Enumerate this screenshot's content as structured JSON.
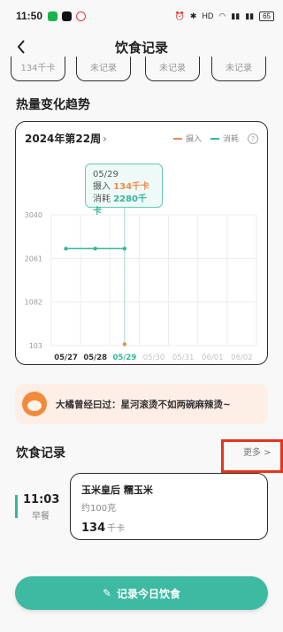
{
  "status_bar": {
    "time": "11:50",
    "battery": "65",
    "network": "HD"
  },
  "nav": {
    "back_icon": "back-icon",
    "title": "饮食记录"
  },
  "day_chips": [
    "134千卡",
    "未记录",
    "未记录",
    "未记录",
    "未记录"
  ],
  "trend": {
    "section_title": "热量变化趋势",
    "week_label": "2024年第22周",
    "legend_intake": "摄入",
    "legend_burn": "消耗",
    "tooltip": {
      "date": "05/29",
      "intake_label": "摄入",
      "intake_value": "134千卡",
      "burn_label": "消耗",
      "burn_value": "2280千卡"
    }
  },
  "chart_data": {
    "type": "line",
    "categories": [
      "05/27",
      "05/28",
      "05/29",
      "05/30",
      "05/31",
      "06/01",
      "06/02"
    ],
    "y_ticks": [
      "3040",
      "2061",
      "1082",
      "103"
    ],
    "ylim": [
      103,
      3040
    ],
    "selected_category": "05/29",
    "series": [
      {
        "name": "消耗",
        "color": "#38b49d",
        "values": [
          2280,
          2280,
          2280,
          null,
          null,
          null,
          null
        ]
      },
      {
        "name": "摄入",
        "color": "#f08a4b",
        "values": [
          null,
          null,
          134,
          null,
          null,
          null,
          null
        ]
      }
    ]
  },
  "quote": {
    "text": "大橘曾经曰过：星河滚烫不如两碗麻辣烫~",
    "avatar_icon": "cat-mascot-icon"
  },
  "diet_record": {
    "section_title": "饮食记录",
    "more_label": "更多 >",
    "meal": {
      "time": "11:03",
      "type": "早餐",
      "food_name": "玉米皇后 糯玉米",
      "amount": "约100克",
      "calories": "134",
      "calories_unit": "千卡"
    }
  },
  "action": {
    "record_button_label": "记录今日饮食",
    "icon": "pencil-icon"
  },
  "colors": {
    "accent": "#3eb9a2",
    "intake": "#f08a4b",
    "burn": "#38b49d",
    "highlight": "#e8331c"
  }
}
